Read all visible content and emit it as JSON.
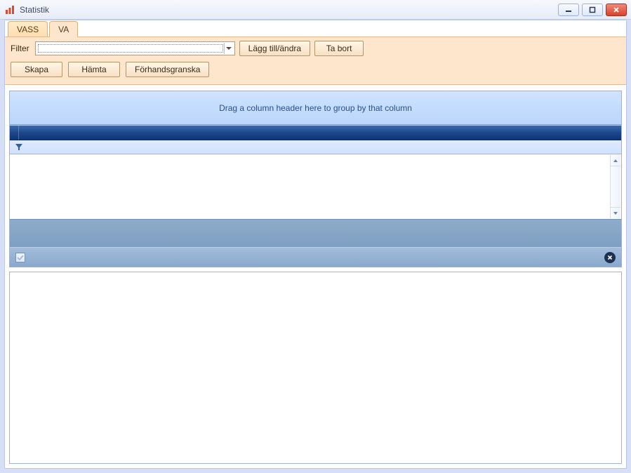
{
  "window": {
    "title": "Statistik"
  },
  "tabs": [
    {
      "label": "VASS",
      "active": false
    },
    {
      "label": "VA",
      "active": true
    }
  ],
  "filter": {
    "label": "Filter",
    "selected": "",
    "buttons": {
      "edit": "Lägg till/ändra",
      "remove": "Ta bort"
    }
  },
  "actions": {
    "create": "Skapa",
    "fetch": "Hämta",
    "preview": "Förhandsgranska"
  },
  "grid": {
    "group_hint": "Drag a column header here to group by that column"
  }
}
